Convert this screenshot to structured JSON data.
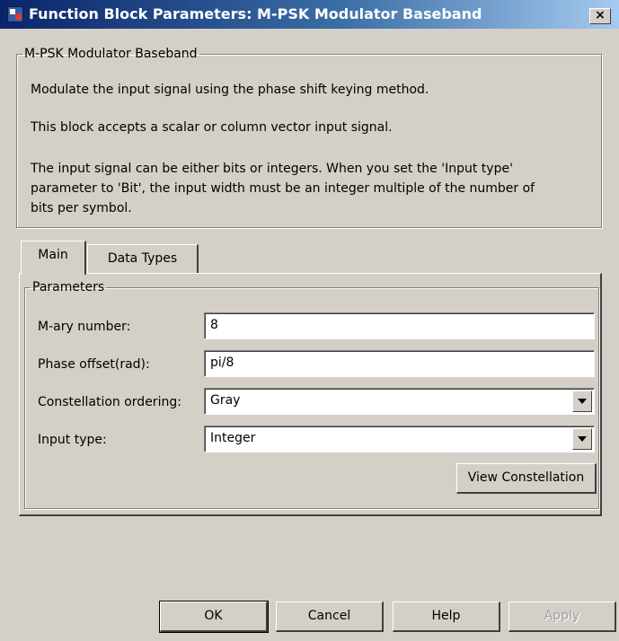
{
  "window": {
    "title": "Function Block Parameters: M-PSK Modulator Baseband",
    "close_label": "×"
  },
  "description": {
    "group_title": "M-PSK Modulator Baseband",
    "line1": "Modulate the input signal using the phase shift keying method.",
    "line2": "This block accepts a scalar or column vector input signal.",
    "line3a": "The input signal can be either bits or integers. When you set the 'Input type'",
    "line3b": "parameter to 'Bit', the input width must be an integer multiple of the number of",
    "line3c": "bits per symbol."
  },
  "tabs": [
    {
      "label": "Main",
      "selected": true
    },
    {
      "label": "Data Types",
      "selected": false
    }
  ],
  "parameters": {
    "group_title": "Parameters",
    "mary": {
      "label": "M-ary number:",
      "value": "8"
    },
    "phase": {
      "label": "Phase offset(rad):",
      "value": "pi/8"
    },
    "ordering": {
      "label": "Constellation ordering:",
      "value": "Gray"
    },
    "input_type": {
      "label": "Input type:",
      "value": "Integer"
    },
    "view_button": "View Constellation"
  },
  "buttons": {
    "ok": "OK",
    "cancel": "Cancel",
    "help": "Help",
    "apply": "Apply"
  },
  "icons": {
    "app": "simulink-block-icon",
    "close": "close-icon",
    "dropdown": "chevron-down-icon"
  }
}
